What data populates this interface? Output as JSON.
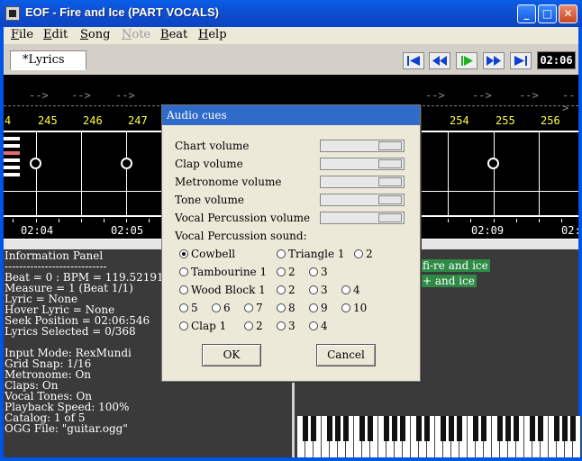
{
  "window": {
    "title": "EOF - Fire and Ice (PART VOCALS)"
  },
  "menu": [
    {
      "label": "File",
      "enabled": true
    },
    {
      "label": "Edit",
      "enabled": true
    },
    {
      "label": "Song",
      "enabled": true
    },
    {
      "label": "Note",
      "enabled": false
    },
    {
      "label": "Beat",
      "enabled": true
    },
    {
      "label": "Help",
      "enabled": true
    }
  ],
  "toolbar": {
    "tab_label": "*Lyrics",
    "buttons": [
      "rewind-to-start",
      "rewind",
      "play",
      "fast-forward",
      "seek-end"
    ],
    "time": "02:06"
  },
  "editor": {
    "arrow_text": "-->",
    "measures": [
      "4",
      "245",
      "246",
      "247",
      "254",
      "255",
      "256"
    ],
    "times": [
      "02:04",
      "02:05",
      "02:09",
      "02:"
    ]
  },
  "info": {
    "lines": [
      "Information Panel",
      "----------------------------",
      "Beat = 0 : BPM = 119.521912",
      "Measure = 1 (Beat 1/1)",
      "Lyric = None",
      "Hover Lyric = None",
      "Seek Position = 02:06:546",
      "Lyrics Selected = 0/368",
      "",
      "Input Mode: RexMundi",
      "Grid Snap: 1/16",
      "Metronome: On",
      "Claps: On",
      "Vocal Tones: On",
      "Playback Speed: 100%",
      "Catalog: 1 of 5",
      "OGG File: \"guitar.ogg\""
    ]
  },
  "lyrics_panel": {
    "chips": [
      "fi-re and ice",
      "+ and ice"
    ]
  },
  "dialog": {
    "title": "Audio cues",
    "volumes": [
      {
        "label": "Chart volume",
        "value": 1.0
      },
      {
        "label": "Clap volume",
        "value": 1.0
      },
      {
        "label": "Metronome volume",
        "value": 1.0
      },
      {
        "label": "Tone volume",
        "value": 1.0
      },
      {
        "label": "Vocal Percussion volume",
        "value": 1.0
      }
    ],
    "sound_label": "Vocal Percussion sound:",
    "sounds": [
      {
        "label": "Cowbell",
        "selected": true
      },
      {
        "label": "Triangle 1",
        "selected": false
      },
      {
        "label": "2",
        "selected": false
      },
      {
        "label": "Tambourine 1",
        "selected": false
      },
      {
        "label": "2",
        "selected": false
      },
      {
        "label": "3",
        "selected": false
      },
      {
        "label": "Wood Block 1",
        "selected": false
      },
      {
        "label": "2",
        "selected": false
      },
      {
        "label": "3",
        "selected": false
      },
      {
        "label": "4",
        "selected": false
      },
      {
        "label": "5",
        "selected": false
      },
      {
        "label": "6",
        "selected": false
      },
      {
        "label": "7",
        "selected": false
      },
      {
        "label": "8",
        "selected": false
      },
      {
        "label": "9",
        "selected": false
      },
      {
        "label": "10",
        "selected": false
      },
      {
        "label": "Clap 1",
        "selected": false
      },
      {
        "label": "2",
        "selected": false
      },
      {
        "label": "3",
        "selected": false
      },
      {
        "label": "4",
        "selected": false
      }
    ],
    "ok_label": "OK",
    "cancel_label": "Cancel"
  }
}
